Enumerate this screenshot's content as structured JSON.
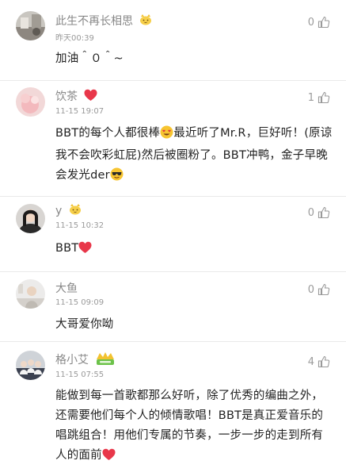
{
  "comments": [
    {
      "username": "此生不再长相思",
      "timestamp": "昨天00:39",
      "likes": "0",
      "text": "加油＾０＾~",
      "badge_icon": "cat-face-badge-icon"
    },
    {
      "username": "饮茶",
      "timestamp": "11-15 19:07",
      "likes": "1",
      "text_parts": [
        "BBT的每个人都很棒",
        "最近听了Mr.R，巨好听！(原谅我不会吹彩虹屁)然后被圈粉了。BBT冲鸭，金子早晚会发光der"
      ],
      "name_icon": "red-heart-icon",
      "emoji_icons": [
        "heart-eyes-emoji-icon",
        "sunglasses-emoji-icon"
      ]
    },
    {
      "username": "y",
      "timestamp": "11-15 10:32",
      "likes": "0",
      "text": "BBT",
      "badge_icon": "cat-face-badge-icon",
      "emoji_icons": [
        "red-heart-icon"
      ]
    },
    {
      "username": "大鱼",
      "timestamp": "11-15 09:09",
      "likes": "0",
      "text": "大哥爱你呦"
    },
    {
      "username": "格小艾",
      "timestamp": "11-15 07:55",
      "likes": "4",
      "text": "能做到每一首歌都那么好听，除了优秀的编曲之外，还需要他们每个人的倾情歌唱！BBT是真正爱音乐的唱跳组合！用他们专属的节奏，一步一步的走到所有人的面前",
      "badge_icon": "green-level-badge-icon",
      "emoji_icons": [
        "red-heart-icon"
      ]
    }
  ],
  "colors": {
    "name": "#888888",
    "time": "#9a9a9a",
    "text": "#222222",
    "heart": "#e8374a",
    "divider": "#e9e9e9"
  },
  "icons": {
    "like": "thumbs-up-icon"
  }
}
